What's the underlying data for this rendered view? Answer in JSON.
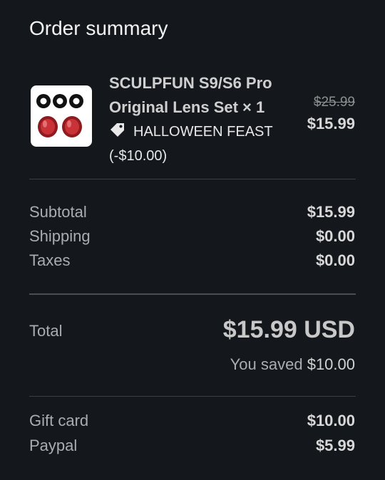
{
  "page": {
    "title": "Order summary"
  },
  "product": {
    "name": "SCULPFUN S9/S6 Pro Original Lens Set × 1",
    "image_icon": "lens-set-thumbnail",
    "discount_code": "HALLOWEEN FEAST",
    "discount_amount": "(-$10.00)",
    "original_price": "$25.99",
    "price": "$15.99"
  },
  "costs": [
    {
      "label": "Subtotal",
      "value": "$15.99"
    },
    {
      "label": "Shipping",
      "value": "$0.00"
    },
    {
      "label": "Taxes",
      "value": "$0.00"
    }
  ],
  "total": {
    "label": "Total",
    "value": "$15.99 USD",
    "saved_label": "You saved",
    "saved_amount": "$10.00"
  },
  "payments": [
    {
      "label": "Gift card",
      "value": "$10.00"
    },
    {
      "label": "Paypal",
      "value": "$5.99"
    }
  ],
  "colors": {
    "background": "#14181c",
    "divider": "#3a3f44",
    "lens_red": "#b2262b"
  }
}
